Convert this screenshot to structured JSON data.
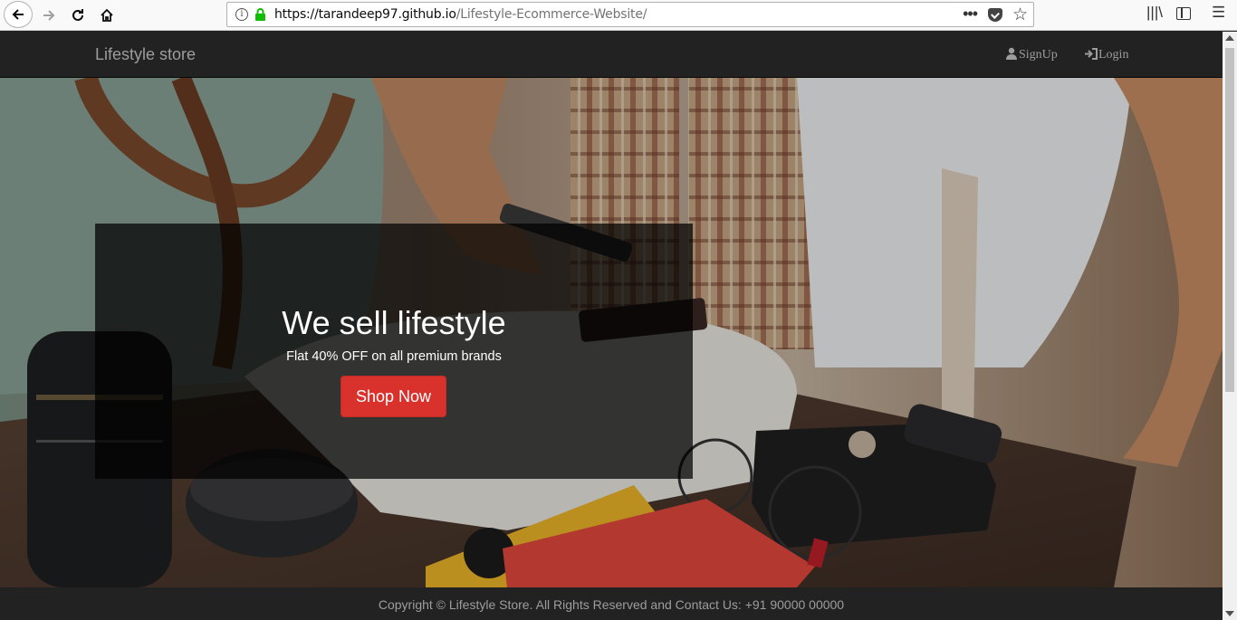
{
  "browser": {
    "url_scheme_host": "https://tarandeep97.github.io",
    "url_path": "/Lifestyle-Ecommerce-Website/",
    "menu_dots": "•••",
    "star": "☆",
    "library": "|||\\",
    "menu": "☰"
  },
  "navbar": {
    "brand": "Lifestyle store",
    "signup_label": "SignUp",
    "login_label": "Login"
  },
  "hero": {
    "title": "We sell lifestyle",
    "subtitle": "Flat 40% OFF on all premium brands",
    "button_label": "Shop Now"
  },
  "footer": {
    "text": "Copyright © Lifestyle Store. All Rights Reserved and Contact Us: +91 90000 00000"
  },
  "colors": {
    "navbar_bg": "#222222",
    "nav_text": "#9d9d9d",
    "button_red": "#d9312c"
  }
}
